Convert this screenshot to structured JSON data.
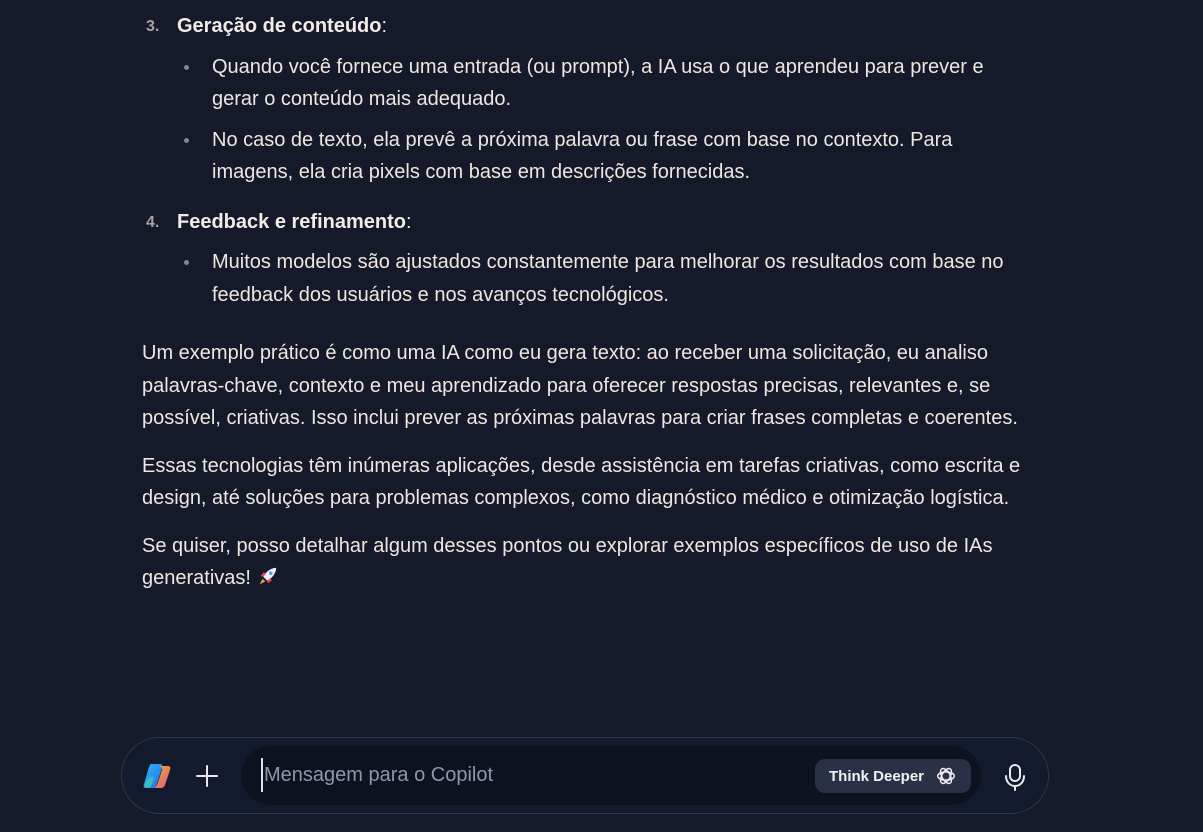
{
  "steps": [
    {
      "number": "3.",
      "title": "Geração de conteúdo",
      "suffix": ":",
      "bullets": [
        "Quando você fornece uma entrada (ou prompt), a IA usa o que aprendeu para prever e gerar o conteúdo mais adequado.",
        "No caso de texto, ela prevê a próxima palavra ou frase com base no contexto. Para imagens, ela cria pixels com base em descrições fornecidas."
      ]
    },
    {
      "number": "4.",
      "title": "Feedback e refinamento",
      "suffix": ":",
      "bullets": [
        "Muitos modelos são ajustados constantemente para melhorar os resultados com base no feedback dos usuários e nos avanços tecnológicos."
      ]
    }
  ],
  "paragraphs": [
    "Um exemplo prático é como uma IA como eu gera texto: ao receber uma solicitação, eu analiso palavras-chave, contexto e meu aprendizado para oferecer respostas precisas, relevantes e, se possível, criativas. Isso inclui prever as próximas palavras para criar frases completas e coerentes.",
    "Essas tecnologias têm inúmeras aplicações, desde assistência em tarefas criativas, como escrita e design, até soluções para problemas complexos, como diagnóstico médico e otimização logística.",
    "Se quiser, posso detalhar algum desses pontos ou explorar exemplos específicos de uso de IAs generativas!"
  ],
  "composer": {
    "placeholder": "Mensagem para o Copilot",
    "value": "",
    "think_deeper_label": "Think Deeper"
  },
  "icons": {
    "logo": "copilot-logo-icon",
    "plus": "plus-icon",
    "think": "think-deeper-icon",
    "mic": "microphone-icon",
    "emoji": "rocket-icon"
  },
  "colors": {
    "background": "#141a2a",
    "text": "#f0e6de",
    "button_bg": "#2a3046"
  }
}
